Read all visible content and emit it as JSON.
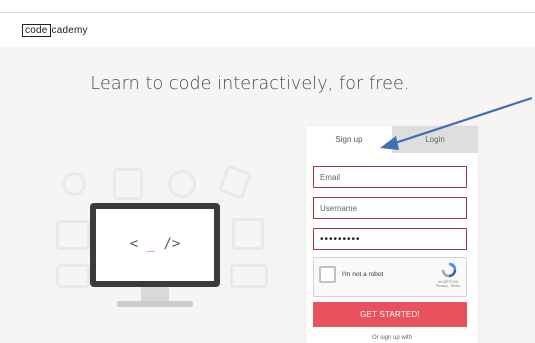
{
  "header": {
    "logo_boxed": "code",
    "logo_rest": "cademy"
  },
  "hero": {
    "title": "Learn to code interactively, for free.",
    "monitor_code_pre": "<",
    "monitor_code_underscore": "_",
    "monitor_code_post": "/>"
  },
  "signup": {
    "tabs": [
      {
        "label": "Sign up",
        "active": true
      },
      {
        "label": "Login",
        "active": false
      }
    ],
    "email_placeholder": "Email",
    "username_placeholder": "Username",
    "password_value": "•••••••••",
    "captcha_label": "I'm not a robot",
    "captcha_brand": "reCAPTCHA",
    "captcha_terms": "Privacy - Terms",
    "submit_label": "GET STARTED!",
    "or_text": "Or sign up with"
  },
  "colors": {
    "accent": "#e9515d",
    "field_border": "#a93a3a",
    "annotation_arrow": "#3f6fb5"
  }
}
